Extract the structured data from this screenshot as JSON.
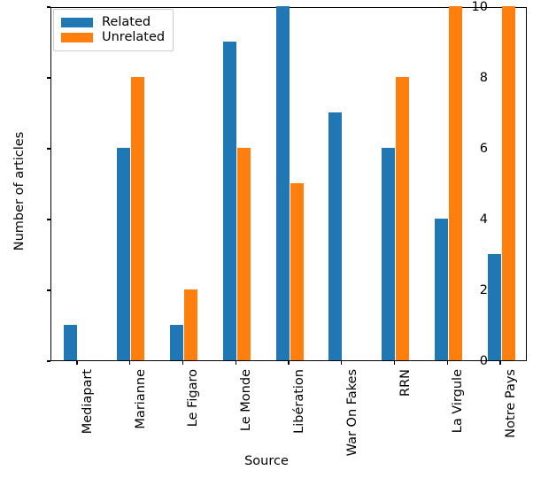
{
  "chart_data": {
    "type": "bar",
    "title": "",
    "xlabel": "Source",
    "ylabel": "Number of articles",
    "categories": [
      "Mediapart",
      "Marianne",
      "Le Figaro",
      "Le Monde",
      "Libération",
      "War On Fakes",
      "RRN",
      "La Virgule",
      "Notre Pays"
    ],
    "series": [
      {
        "name": "Related",
        "color": "#1f77b4",
        "values": [
          1,
          6,
          1,
          9,
          10,
          7,
          6,
          4,
          3
        ]
      },
      {
        "name": "Unrelated",
        "color": "#ff7f0e",
        "values": [
          0,
          8,
          2,
          6,
          5,
          0,
          8,
          10,
          10
        ]
      }
    ],
    "ylim": [
      0,
      10
    ],
    "yticks": [
      0,
      2,
      4,
      6,
      8,
      10
    ],
    "ytick_labels": [
      "0",
      "2",
      "4",
      "6",
      "8",
      "10"
    ],
    "grid": false,
    "legend_position": "upper left"
  }
}
